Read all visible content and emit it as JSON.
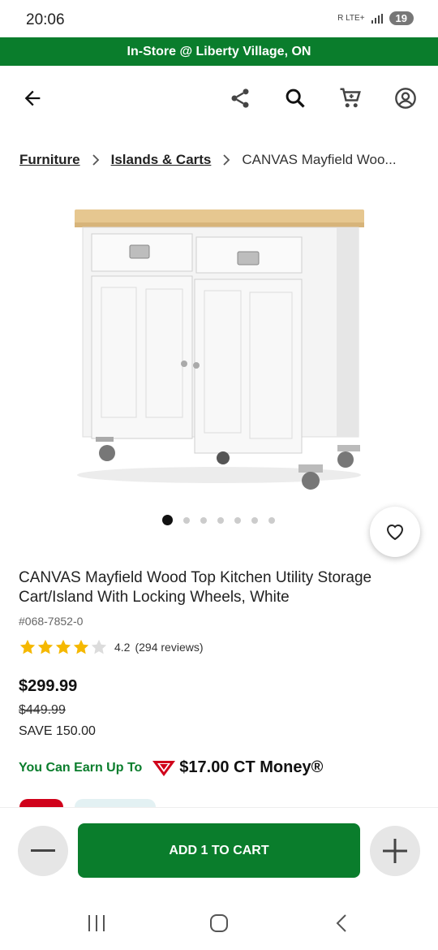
{
  "status_bar": {
    "time": "20:06",
    "signal_text": "R LTE+",
    "battery": "19"
  },
  "store_banner": {
    "text": "In-Store @ Liberty Village, ON"
  },
  "nav": {
    "icons": [
      "back-arrow-icon",
      "share-icon",
      "search-icon",
      "cart-icon",
      "account-icon"
    ]
  },
  "breadcrumb": {
    "items": [
      "Furniture",
      "Islands & Carts"
    ],
    "current": "CANVAS Mayfield Woo..."
  },
  "carousel": {
    "total": 7,
    "active_index": 0
  },
  "product": {
    "title": "CANVAS Mayfield Wood Top Kitchen Utility Storage Cart/Island With Locking Wheels, White",
    "sku": "#068-7852-0",
    "rating_value": "4.2",
    "rating_stars": 4.2,
    "reviews": "(294 reviews)",
    "price": "$299.99",
    "old_price": "$449.99",
    "save": "SAVE 150.00"
  },
  "ct_money": {
    "label": "You Can Earn Up To",
    "amount": "$17.00 CT Money®"
  },
  "cart_bar": {
    "add_label": "ADD 1 TO CART"
  },
  "colors": {
    "brand_green": "#0a7d2c",
    "ct_red": "#d0021b",
    "star": "#f5b800"
  }
}
